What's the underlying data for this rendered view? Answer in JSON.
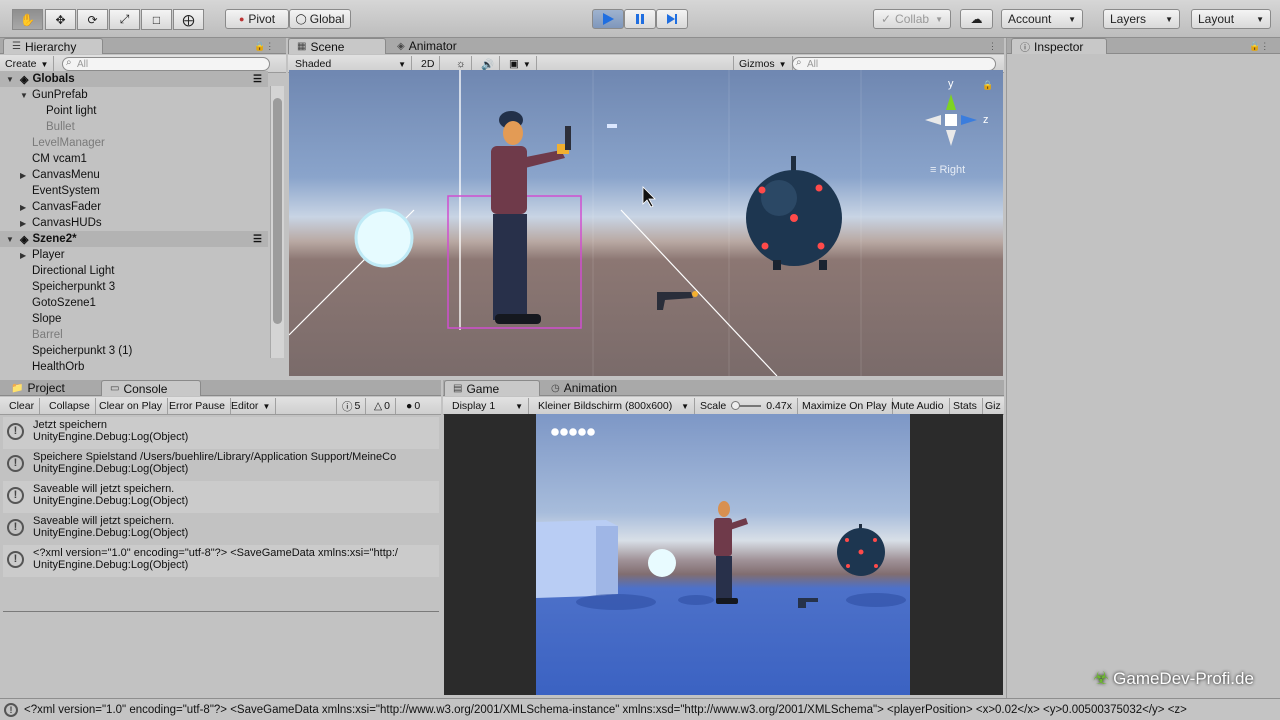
{
  "toolbar": {
    "tools": [
      "hand-icon",
      "move-icon",
      "rotate-icon",
      "scale-icon",
      "rect-icon",
      "transform-icon"
    ],
    "pivot": "Pivot",
    "global": "Global",
    "collab": "Collab",
    "account": "Account",
    "layers": "Layers",
    "layout": "Layout",
    "play_color": "#3a7bd5"
  },
  "hierarchy": {
    "tab": "Hierarchy",
    "create": "Create",
    "search_placeholder": "All",
    "scenes": [
      {
        "name": "Globals",
        "items": [
          {
            "label": "GunPrefab",
            "expand": true,
            "indent": 1,
            "muted": false
          },
          {
            "label": "Point light",
            "expand": false,
            "indent": 2,
            "muted": false
          },
          {
            "label": "Bullet",
            "expand": false,
            "indent": 2,
            "muted": true
          },
          {
            "label": "LevelManager",
            "expand": false,
            "indent": 1,
            "muted": true
          },
          {
            "label": "CM vcam1",
            "expand": false,
            "indent": 1,
            "muted": false
          },
          {
            "label": "CanvasMenu",
            "expand": true,
            "indent": 1,
            "muted": false
          },
          {
            "label": "EventSystem",
            "expand": false,
            "indent": 1,
            "muted": false
          },
          {
            "label": "CanvasFader",
            "expand": true,
            "indent": 1,
            "muted": false
          },
          {
            "label": "CanvasHUDs",
            "expand": true,
            "indent": 1,
            "muted": false
          }
        ]
      },
      {
        "name": "Szene2*",
        "items": [
          {
            "label": "Player",
            "expand": true,
            "indent": 1,
            "muted": false
          },
          {
            "label": "Directional Light",
            "expand": false,
            "indent": 1,
            "muted": false
          },
          {
            "label": "Speicherpunkt 3",
            "expand": false,
            "indent": 1,
            "muted": false
          },
          {
            "label": "GotoSzene1",
            "expand": false,
            "indent": 1,
            "muted": false
          },
          {
            "label": "Slope",
            "expand": false,
            "indent": 1,
            "muted": false
          },
          {
            "label": "Barrel",
            "expand": false,
            "indent": 1,
            "muted": true
          },
          {
            "label": "Speicherpunkt 3 (1)",
            "expand": false,
            "indent": 1,
            "muted": false
          },
          {
            "label": "HealthOrb",
            "expand": false,
            "indent": 1,
            "muted": false
          }
        ]
      }
    ]
  },
  "scene": {
    "tab": "Scene",
    "animator_tab": "Animator",
    "shaded": "Shaded",
    "mode_2d": "2D",
    "gizmos": "Gizmos",
    "search_placeholder": "All",
    "axis_y": "y",
    "axis_z": "z",
    "view_label": "Right"
  },
  "inspector": {
    "tab": "Inspector"
  },
  "console": {
    "project_tab": "Project",
    "console_tab": "Console",
    "buttons": [
      "Clear",
      "Collapse",
      "Clear on Play",
      "Error Pause",
      "Editor"
    ],
    "count_info": "5",
    "count_warn": "0",
    "count_error": "0",
    "entries": [
      {
        "line1": "Jetzt speichern",
        "line2": "UnityEngine.Debug:Log(Object)"
      },
      {
        "line1": "Speichere Spielstand /Users/buehlire/Library/Application Support/MeineCo",
        "line2": "UnityEngine.Debug:Log(Object)"
      },
      {
        "line1": "Saveable will jetzt speichern.",
        "line2": "UnityEngine.Debug:Log(Object)"
      },
      {
        "line1": "Saveable will jetzt speichern.",
        "line2": "UnityEngine.Debug:Log(Object)"
      },
      {
        "line1": "<?xml version=\"1.0\" encoding=\"utf-8\"?> <SaveGameData xmlns:xsi=\"http:/",
        "line2": "UnityEngine.Debug:Log(Object)"
      }
    ]
  },
  "game": {
    "tab": "Game",
    "animation_tab": "Animation",
    "display": "Display 1",
    "resolution": "Kleiner Bildschirm (800x600)",
    "scale_label": "Scale",
    "scale_value": "0.47x",
    "maximize": "Maximize On Play",
    "mute": "Mute Audio",
    "stats": "Stats",
    "gizmos": "Giz",
    "health_dots": 5
  },
  "status_bar": "<?xml version=\"1.0\" encoding=\"utf-8\"?> <SaveGameData xmlns:xsi=\"http://www.w3.org/2001/XMLSchema-instance\" xmlns:xsd=\"http://www.w3.org/2001/XMLSchema\"> <playerPosition> <x>0.02</x> <y>0.00500375032</y> <z>",
  "watermark": "GameDev-Profi.de"
}
